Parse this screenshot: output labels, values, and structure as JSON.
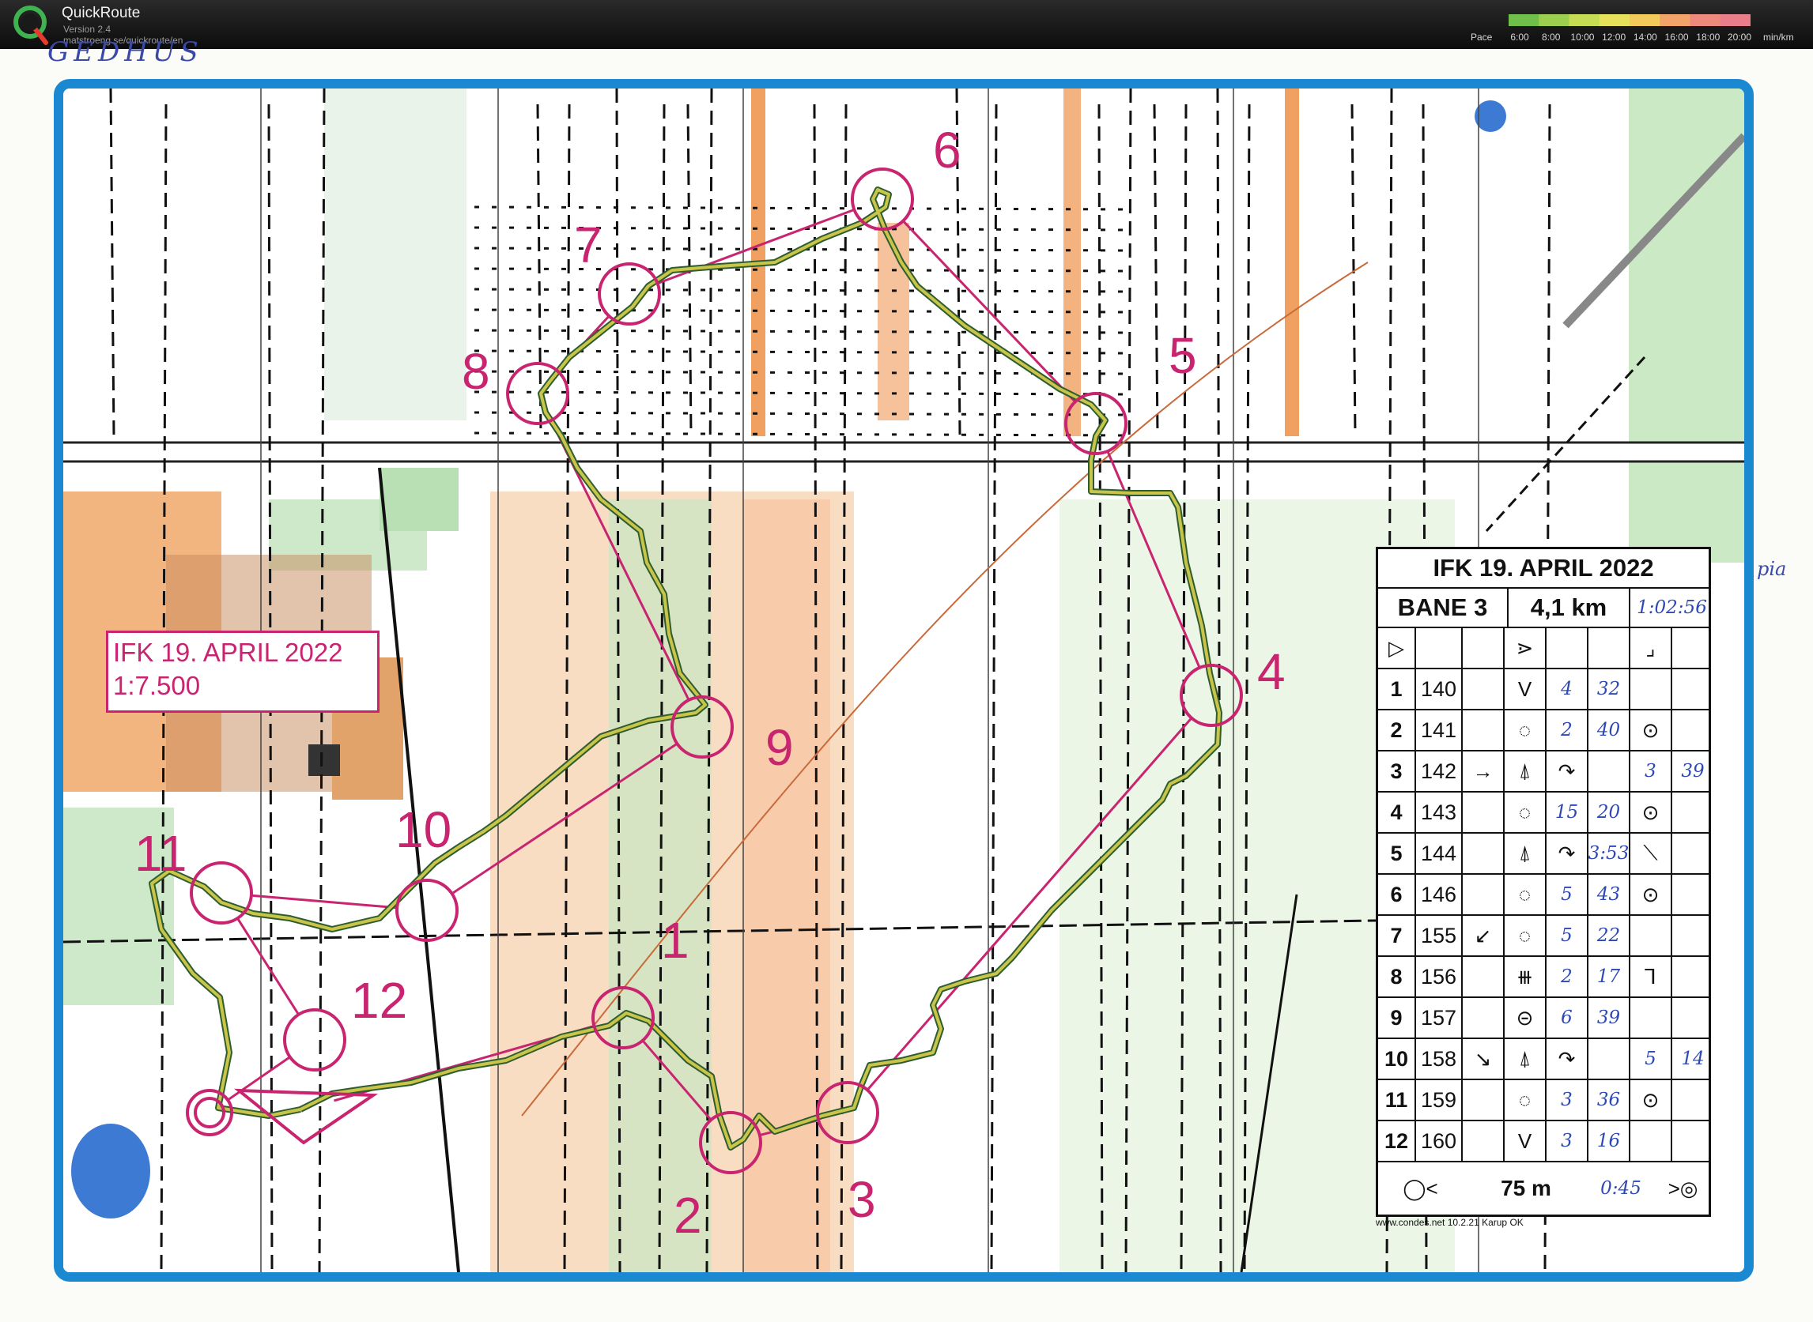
{
  "app": {
    "name": "QuickRoute",
    "version": "Version 2.4",
    "url": "matstroeng.se/quickroute/en",
    "pace_label": "Pace",
    "pace_ticks": [
      "6:00",
      "8:00",
      "10:00",
      "12:00",
      "14:00",
      "16:00",
      "18:00",
      "20:00"
    ],
    "pace_unit": "min/km",
    "pace_colors": [
      "#6fbf4a",
      "#9ccf4e",
      "#c7dc55",
      "#e6e05a",
      "#f2c95b",
      "#f2a36a",
      "#ee8a7c",
      "#ea7d8a"
    ]
  },
  "map": {
    "handwriting_top": "GEDHUS",
    "handwriting_right": "pia",
    "title_line1": "IFK 19. APRIL 2022",
    "title_line2": "1:7.500",
    "colors": {
      "frame": "#1b89d2",
      "course": "#c8246f",
      "route_outer": "#2f5d2e",
      "route_inner": "#c9c44a",
      "rough_open": "#f6c9a6",
      "forest_green": "#b9dfb4",
      "road": "#f0a060",
      "building": "#d9a070"
    },
    "controls": [
      {
        "label": "1"
      },
      {
        "label": "2"
      },
      {
        "label": "3"
      },
      {
        "label": "4"
      },
      {
        "label": "5"
      },
      {
        "label": "6"
      },
      {
        "label": "7"
      },
      {
        "label": "8"
      },
      {
        "label": "9"
      },
      {
        "label": "10"
      },
      {
        "label": "11"
      },
      {
        "label": "12"
      }
    ]
  },
  "description": {
    "title": "IFK 19. APRIL 2022",
    "course": "BANE 3",
    "length": "4,1 km",
    "total_time": "1:02:56",
    "rows": [
      {
        "num": "1",
        "code": "140",
        "c": "",
        "d": "V",
        "split": "4",
        "total": "32",
        "g": "",
        "h": ""
      },
      {
        "num": "2",
        "code": "141",
        "c": "",
        "d": "◌",
        "split": "2",
        "total": "40",
        "g": "⊙",
        "h": ""
      },
      {
        "num": "3",
        "code": "142",
        "c": "→",
        "d": "⍋",
        "split": "↷",
        "total": "",
        "g": "3",
        "h": "39"
      },
      {
        "num": "4",
        "code": "143",
        "c": "",
        "d": "◌",
        "split": "15",
        "total": "20",
        "g": "⊙",
        "h": ""
      },
      {
        "num": "5",
        "code": "144",
        "c": "",
        "d": "⍋",
        "split": "↷",
        "total": "3:53",
        "g": "⟍",
        "h": ""
      },
      {
        "num": "6",
        "code": "146",
        "c": "",
        "d": "◌",
        "split": "5",
        "total": "43",
        "g": "⊙",
        "h": ""
      },
      {
        "num": "7",
        "code": "155",
        "c": "↙",
        "d": "◌",
        "split": "5",
        "total": "22",
        "g": "",
        "h": ""
      },
      {
        "num": "8",
        "code": "156",
        "c": "",
        "d": "⧻",
        "split": "2",
        "total": "17",
        "g": "⅂",
        "h": ""
      },
      {
        "num": "9",
        "code": "157",
        "c": "",
        "d": "⊝",
        "split": "6",
        "total": "39",
        "g": "",
        "h": ""
      },
      {
        "num": "10",
        "code": "158",
        "c": "↘",
        "d": "⍋",
        "split": "↷",
        "total": "",
        "g": "5",
        "h": "14"
      },
      {
        "num": "11",
        "code": "159",
        "c": "",
        "d": "◌",
        "split": "3",
        "total": "36",
        "g": "⊙",
        "h": ""
      },
      {
        "num": "12",
        "code": "160",
        "c": "",
        "d": "V",
        "split": "3",
        "total": "16",
        "g": "",
        "h": ""
      }
    ],
    "finish_distance": "75 m",
    "finish_time": "0:45",
    "footer": "www.condes.net 10.2.21 Karup OK"
  }
}
